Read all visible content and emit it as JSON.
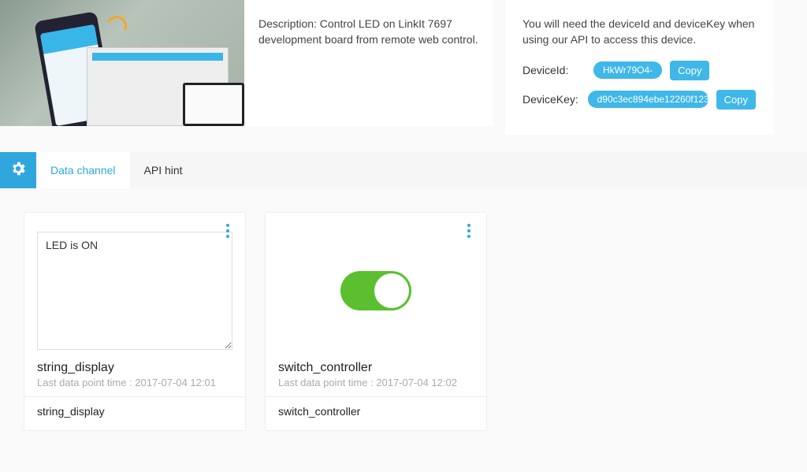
{
  "info": {
    "description": "Description: Control LED on LinkIt 7697 development board from remote web control."
  },
  "device": {
    "api_note": "You will need the deviceId and deviceKey when using our API to access this device.",
    "id_label": "DeviceId:",
    "id_value": "HkWr79O4-",
    "key_label": "DeviceKey:",
    "key_value": "d90c3ec894ebe12260f123",
    "copy_label": "Copy"
  },
  "tabs": {
    "data_channel": "Data channel",
    "api_hint": "API hint"
  },
  "channels": [
    {
      "type": "string",
      "value": "LED is ON",
      "title": "string_display",
      "last_point_prefix": "Last data point time : ",
      "last_point_time": "2017-07-04 12:01",
      "name": "string_display"
    },
    {
      "type": "switch",
      "state": "on",
      "title": "switch_controller",
      "last_point_prefix": "Last data point time : ",
      "last_point_time": "2017-07-04 12:02",
      "name": "switch_controller"
    }
  ]
}
